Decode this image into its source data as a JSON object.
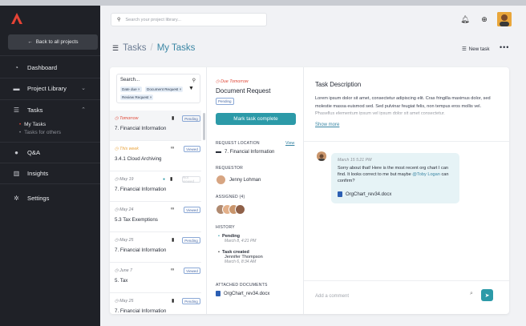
{
  "colors": {
    "accent": "#2c9aa8",
    "danger": "#e04a3a",
    "sidebar_bg": "#1f2127",
    "logo": "#e54335"
  },
  "sidebar": {
    "back_label": "Back to all projects",
    "items": [
      {
        "label": "Dashboard",
        "icon": "gauge-icon"
      },
      {
        "label": "Project Library",
        "icon": "folder-icon"
      },
      {
        "label": "Tasks",
        "icon": "list-icon"
      },
      {
        "label": "Q&A",
        "icon": "chat-icon"
      },
      {
        "label": "Insights",
        "icon": "chart-icon"
      },
      {
        "label": "Settings",
        "icon": "gear-icon"
      }
    ],
    "task_sub": [
      "My Tasks",
      "Tasks for others"
    ]
  },
  "header": {
    "search_placeholder": "Search your project library..."
  },
  "page": {
    "section": "Tasks",
    "current": "My Tasks",
    "new_task_label": "New task"
  },
  "task_list": {
    "search_label": "Search...",
    "filters": [
      "Date due ×",
      "Document Request ×",
      "Review Request ×"
    ],
    "items": [
      {
        "due": "Tomorrow",
        "name": "7. Financial Information",
        "status": "Pending",
        "icon": "document-icon"
      },
      {
        "due": "This week",
        "name": "3.4.1 Cloud Archiving",
        "status": "Viewed",
        "icon": "glasses-icon"
      },
      {
        "due": "May 19",
        "name": "7. Financial Information",
        "status": "Not viewed",
        "icon": "document-icon"
      },
      {
        "due": "May 24",
        "name": "5.3 Tax Exemptions",
        "status": "Viewed",
        "icon": "glasses-icon"
      },
      {
        "due": "May 25",
        "name": "7. Financial Information",
        "status": "Pending",
        "icon": "document-icon"
      },
      {
        "due": "June 7",
        "name": "5. Tax",
        "status": "Viewed",
        "icon": "glasses-icon"
      },
      {
        "due": "May 25",
        "name": "7. Financial Information",
        "status": "Pending",
        "icon": "document-icon"
      }
    ]
  },
  "detail": {
    "due": "Due Tomorrow",
    "title": "Document Request",
    "badge": "Pending",
    "action_label": "Mark task complete",
    "location_label": "REQUEST LOCATION",
    "location_link": "View",
    "location_value": "7. Financial Information",
    "requestor_label": "REQUESTOR",
    "requestor_name": "Jenny Lohman",
    "assigned_label": "ASSIGNED (4)",
    "history_label": "HISTORY",
    "history": [
      {
        "title": "Pending",
        "time": "March 8, 4:21 PM"
      },
      {
        "title": "Task created",
        "person": "Jennifer Thompson",
        "time": "March 6, 8:34 AM"
      }
    ],
    "attached_label": "ATTACHED DOCUMENTS",
    "attached_file": "OrgChart_rev34.docx"
  },
  "description": {
    "title": "Task Description",
    "text": "Lorem ipsum dolor sit amet, consectetur adipiscing elit. Cras fringilla maximus dolor, sed molestie massa euismod sed. Sed pulvinar feugiat felis, non tempus eros mollis vel. Phasellus elementum ipsum vel ipsum dolor sit amet consectetur.",
    "show_more": "Show more",
    "message": {
      "time": "March 15 5:21 PM",
      "text": "Sorry about that! Here is the most recent org chart I can find. It looks correct to me but maybe",
      "mention": "@Toby Logan",
      "text_after": "can confirm?",
      "attachment": "OrgChart_rev34.docx"
    },
    "comment_placeholder": "Add a comment"
  }
}
